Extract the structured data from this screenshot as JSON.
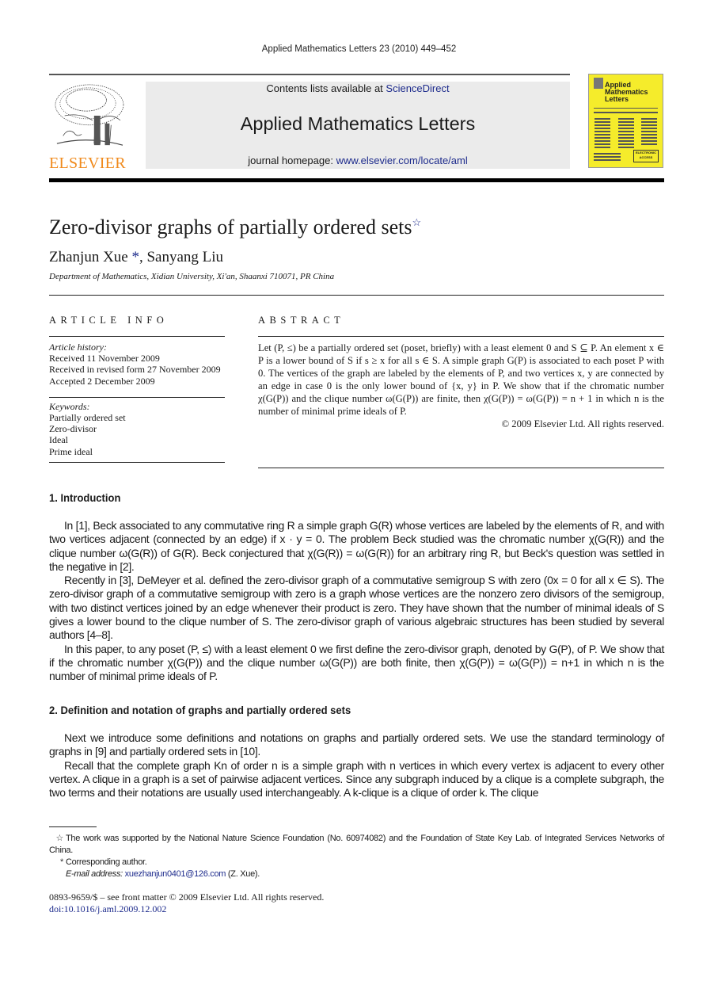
{
  "running_head": "Applied Mathematics Letters 23 (2010) 449–452",
  "header": {
    "publisher_logo_text": "ELSEVIER",
    "contents_prefix": "Contents lists available at ",
    "contents_link": "ScienceDirect",
    "journal_title": "Applied Mathematics Letters",
    "homepage_prefix": "journal homepage: ",
    "homepage_link": "www.elsevier.com/locate/aml",
    "cover": {
      "title_line1": "Applied",
      "title_line2": "Mathematics",
      "title_line3": "Letters",
      "badge": "ELECTRONIC ACCESS",
      "color": "#f5ec2b"
    }
  },
  "article": {
    "title": "Zero-divisor graphs of partially ordered sets",
    "title_note_mark": "☆",
    "author1": "Zhanjun Xue",
    "author1_mark": "*",
    "author_sep": ", ",
    "author2": "Sanyang Liu",
    "affiliation": "Department of Mathematics, Xidian University, Xi'an, Shaanxi 710071, PR China"
  },
  "article_info": {
    "heading": "ARTICLE INFO",
    "history_label": "Article history:",
    "history": [
      "Received 11 November 2009",
      "Received in revised form 27 November 2009",
      "Accepted 2 December 2009"
    ],
    "keywords_label": "Keywords:",
    "keywords": [
      "Partially ordered set",
      "Zero-divisor",
      "Ideal",
      "Prime ideal"
    ]
  },
  "abstract": {
    "heading": "ABSTRACT",
    "text": "Let (P, ≤) be a partially ordered set (poset, briefly) with a least element 0 and S ⊆ P. An element x ∈ P is a lower bound of S if s ≥ x for all s ∈ S. A simple graph G(P) is associated to each poset P with 0. The vertices of the graph are labeled by the elements of P, and two vertices x, y are connected by an edge in case 0 is the only lower bound of {x, y} in P. We show that if the chromatic number χ(G(P)) and the clique number ω(G(P)) are finite, then χ(G(P)) = ω(G(P)) = n + 1 in which n is the number of minimal prime ideals of P.",
    "copyright": "© 2009 Elsevier Ltd. All rights reserved."
  },
  "sections": [
    {
      "heading": "1.  Introduction",
      "paragraphs": [
        "In [1], Beck associated to any commutative ring R a simple graph G(R) whose vertices are labeled by the elements of R, and with two vertices adjacent (connected by an edge) if x · y = 0. The problem Beck studied was the chromatic number χ(G(R)) and the clique number ω(G(R)) of G(R). Beck conjectured that χ(G(R)) = ω(G(R)) for an arbitrary ring R, but Beck's question was settled in the negative in [2].",
        "Recently in [3], DeMeyer et al. defined the zero-divisor graph of a commutative semigroup S with zero (0x = 0 for all x ∈ S). The zero-divisor graph of a commutative semigroup with zero is a graph whose vertices are the nonzero zero divisors of the semigroup, with two distinct vertices joined by an edge whenever their product is zero. They have shown that the number of minimal ideals of S gives a lower bound to the clique number of S. The zero-divisor graph of various algebraic structures has been studied by several authors [4–8].",
        "In this paper, to any poset (P, ≤) with a least element 0 we first define the zero-divisor graph, denoted by G(P), of P. We show that if the chromatic number χ(G(P)) and the clique number ω(G(P)) are both finite, then χ(G(P)) = ω(G(P)) = n+1 in which n is the number of minimal prime ideals of P."
      ]
    },
    {
      "heading": "2.  Definition and notation of graphs and partially ordered sets",
      "paragraphs": [
        "Next we introduce some definitions and notations on graphs and partially ordered sets. We use the standard terminology of graphs in [9] and partially ordered sets in [10].",
        "Recall that the complete graph Kn of order n is a simple graph with n vertices in which every vertex is adjacent to every other vertex. A clique in a graph is a set of pairwise adjacent vertices. Since any subgraph induced by a clique is a complete subgraph, the two terms and their notations are usually used interchangeably. A k-clique is a clique of order k. The clique"
      ]
    }
  ],
  "footnotes": {
    "funding_mark": "☆",
    "funding": "The work was supported by the National Nature Science Foundation (No. 60974082) and the Foundation of State Key Lab. of Integrated Services Networks of China.",
    "corresponding_mark": "*",
    "corresponding": "Corresponding author.",
    "email_label": "E-mail address: ",
    "email": "xuezhanjun0401@126.com",
    "email_suffix": " (Z. Xue)."
  },
  "front_matter": {
    "issn_line": "0893-9659/$ – see front matter © 2009 Elsevier Ltd. All rights reserved.",
    "doi": "doi:10.1016/j.aml.2009.12.002"
  },
  "colors": {
    "link": "#1d2b8c",
    "elsevier_orange": "#f08a1c",
    "banner_bg": "#ebebeb"
  }
}
